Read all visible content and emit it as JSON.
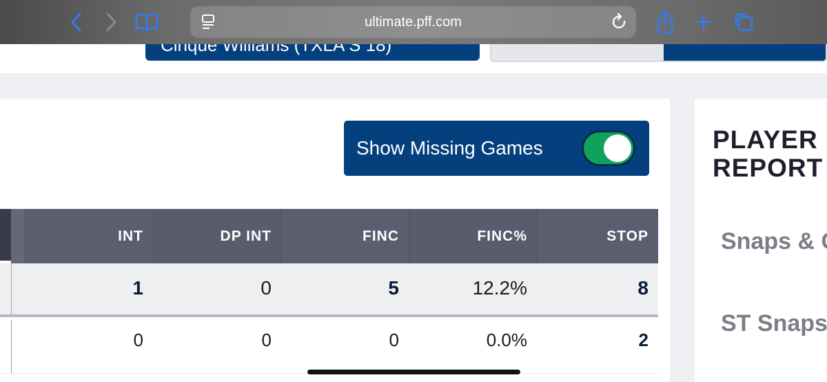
{
  "browser": {
    "url": "ultimate.pff.com",
    "icons": [
      "back-icon",
      "forward-icon",
      "bookmarks-icon",
      "reader-icon",
      "reload-icon",
      "share-icon",
      "new-tab-icon",
      "tabs-icon"
    ],
    "accent": "#2f7cf6"
  },
  "header": {
    "player_select_label": "Cinque Williams (TXLA S 18)"
  },
  "toggle": {
    "label": "Show Missing Games",
    "on": true,
    "on_color": "#0ea25a"
  },
  "table": {
    "columns": [
      "INT",
      "DP INT",
      "FINC",
      "FINC%",
      "STOP"
    ],
    "rows": [
      [
        "1",
        "0",
        "5",
        "12.2%",
        "8"
      ],
      [
        "0",
        "0",
        "0",
        "0.0%",
        "2"
      ]
    ]
  },
  "sidebar": {
    "title": "PLAYER REPORT",
    "links": [
      "Snaps & Grades",
      "ST Snaps Grades"
    ]
  },
  "colors": {
    "brand_blue": "#05407e",
    "header_gray": "#5c5e70"
  }
}
